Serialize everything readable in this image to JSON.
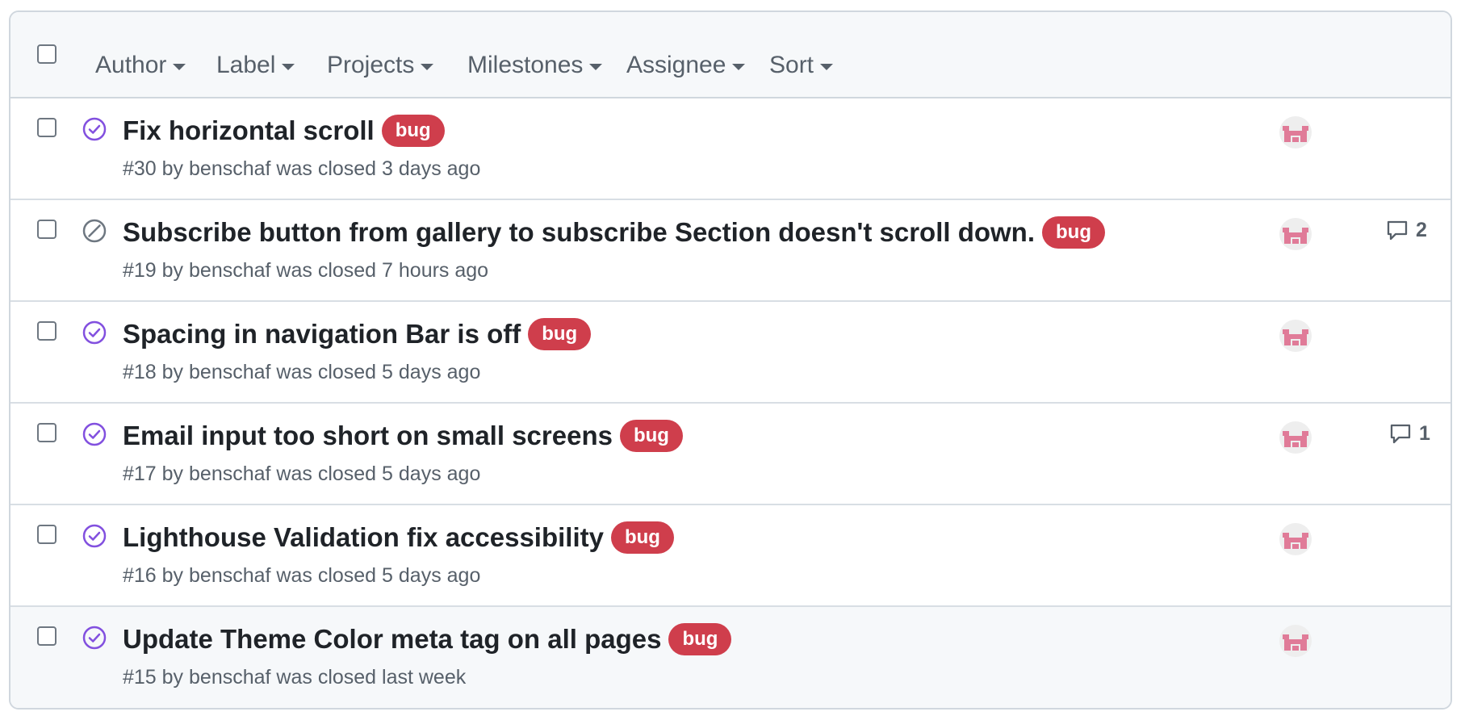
{
  "colors": {
    "closed_completed": "#8250df",
    "closed_not_planned": "#6e7781",
    "label_bg": "#cf3e4c",
    "avatar_pink": "#e07b98"
  },
  "filters": [
    {
      "label": "Author"
    },
    {
      "label": "Label"
    },
    {
      "label": "Projects"
    },
    {
      "label": "Milestones"
    },
    {
      "label": "Assignee"
    },
    {
      "label": "Sort"
    }
  ],
  "issues": [
    {
      "state_icon": "closed-completed-icon",
      "title": "Fix horizontal scroll",
      "label": "bug",
      "meta": "#30 by benschaf was closed 3 days ago",
      "comments": null
    },
    {
      "state_icon": "closed-not-planned-icon",
      "title": "Subscribe button from gallery to subscribe Section doesn't scroll down.",
      "label": "bug",
      "meta": "#19 by benschaf was closed 7 hours ago",
      "comments": "2"
    },
    {
      "state_icon": "closed-completed-icon",
      "title": "Spacing in navigation Bar is off",
      "label": "bug",
      "meta": "#18 by benschaf was closed 5 days ago",
      "comments": null
    },
    {
      "state_icon": "closed-completed-icon",
      "title": "Email input too short on small screens",
      "label": "bug",
      "meta": "#17 by benschaf was closed 5 days ago",
      "comments": "1"
    },
    {
      "state_icon": "closed-completed-icon",
      "title": "Lighthouse Validation fix accessibility",
      "label": "bug",
      "meta": "#16 by benschaf was closed 5 days ago",
      "comments": null
    },
    {
      "state_icon": "closed-completed-icon",
      "title": "Update Theme Color meta tag on all pages",
      "label": "bug",
      "meta": "#15 by benschaf was closed last week",
      "comments": null
    }
  ]
}
